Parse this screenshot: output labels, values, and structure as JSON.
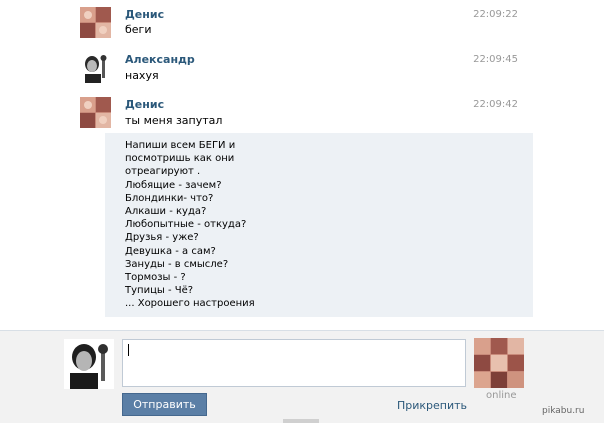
{
  "messages": [
    {
      "author": "Денис",
      "time": "22:09:22",
      "text": "беги",
      "avatar": "denis-avatar"
    },
    {
      "author": "Александр",
      "time": "22:09:45",
      "text": "нахуя",
      "avatar": "alexander-avatar"
    },
    {
      "author": "Денис",
      "time": "22:09:42",
      "text": "ты меня запутал",
      "avatar": "denis-avatar"
    }
  ],
  "quote": {
    "lines": [
      "Напиши всем БЕГИ и",
      "посмотришь как они",
      "отреагируют .",
      "Любящие - зачем?",
      "Блондинки- что?",
      "Алкаши - куда?",
      "Любопытные - откуда?",
      "Друзья - уже?",
      "Девушка - а сам?",
      "Зануды - в смысле?",
      "Тормозы - ?",
      "Тупицы - Чё?",
      "... Хорошего настроения"
    ]
  },
  "composer": {
    "input_value": "",
    "send_label": "Отправить",
    "attach_label": "Прикрепить",
    "peer_status": "online"
  },
  "watermark": "pikabu.ru",
  "colors": {
    "author": "#2b587a",
    "time": "#999999",
    "quote_bg": "#edf1f5",
    "button_bg": "#5b7fa6",
    "footer_bg": "#f2f2f2"
  }
}
